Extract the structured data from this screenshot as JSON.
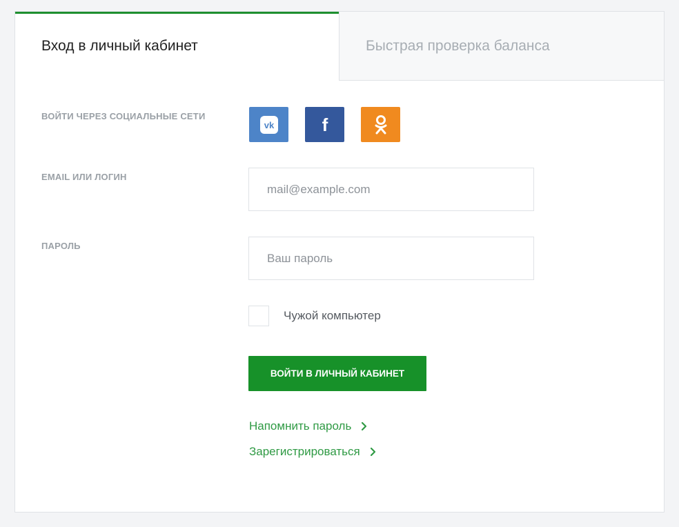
{
  "tabs": {
    "login": "Вход в личный кабинет",
    "balance": "Быстрая проверка баланса"
  },
  "form": {
    "social_label": "Войти через социальные сети",
    "email_label": "Email или логин",
    "email_placeholder": "mail@example.com",
    "password_label": "Пароль",
    "password_placeholder": "Ваш пароль",
    "foreign_computer_label": "Чужой компьютер",
    "submit_label": "Войти в личный кабинет"
  },
  "social": {
    "vk": {
      "icon": "vk-icon",
      "glyph": "vk",
      "color": "#4d84c8"
    },
    "facebook": {
      "icon": "facebook-icon",
      "glyph": "f",
      "color": "#34589c"
    },
    "odnoklassniki": {
      "icon": "odnoklassniki-icon",
      "color": "#f08a1f"
    }
  },
  "links": {
    "remind_password": "Напомнить пароль",
    "register": "Зарегистрироваться"
  },
  "colors": {
    "accent": "#1e8f2f",
    "button": "#179129",
    "link": "#2f9a44"
  }
}
